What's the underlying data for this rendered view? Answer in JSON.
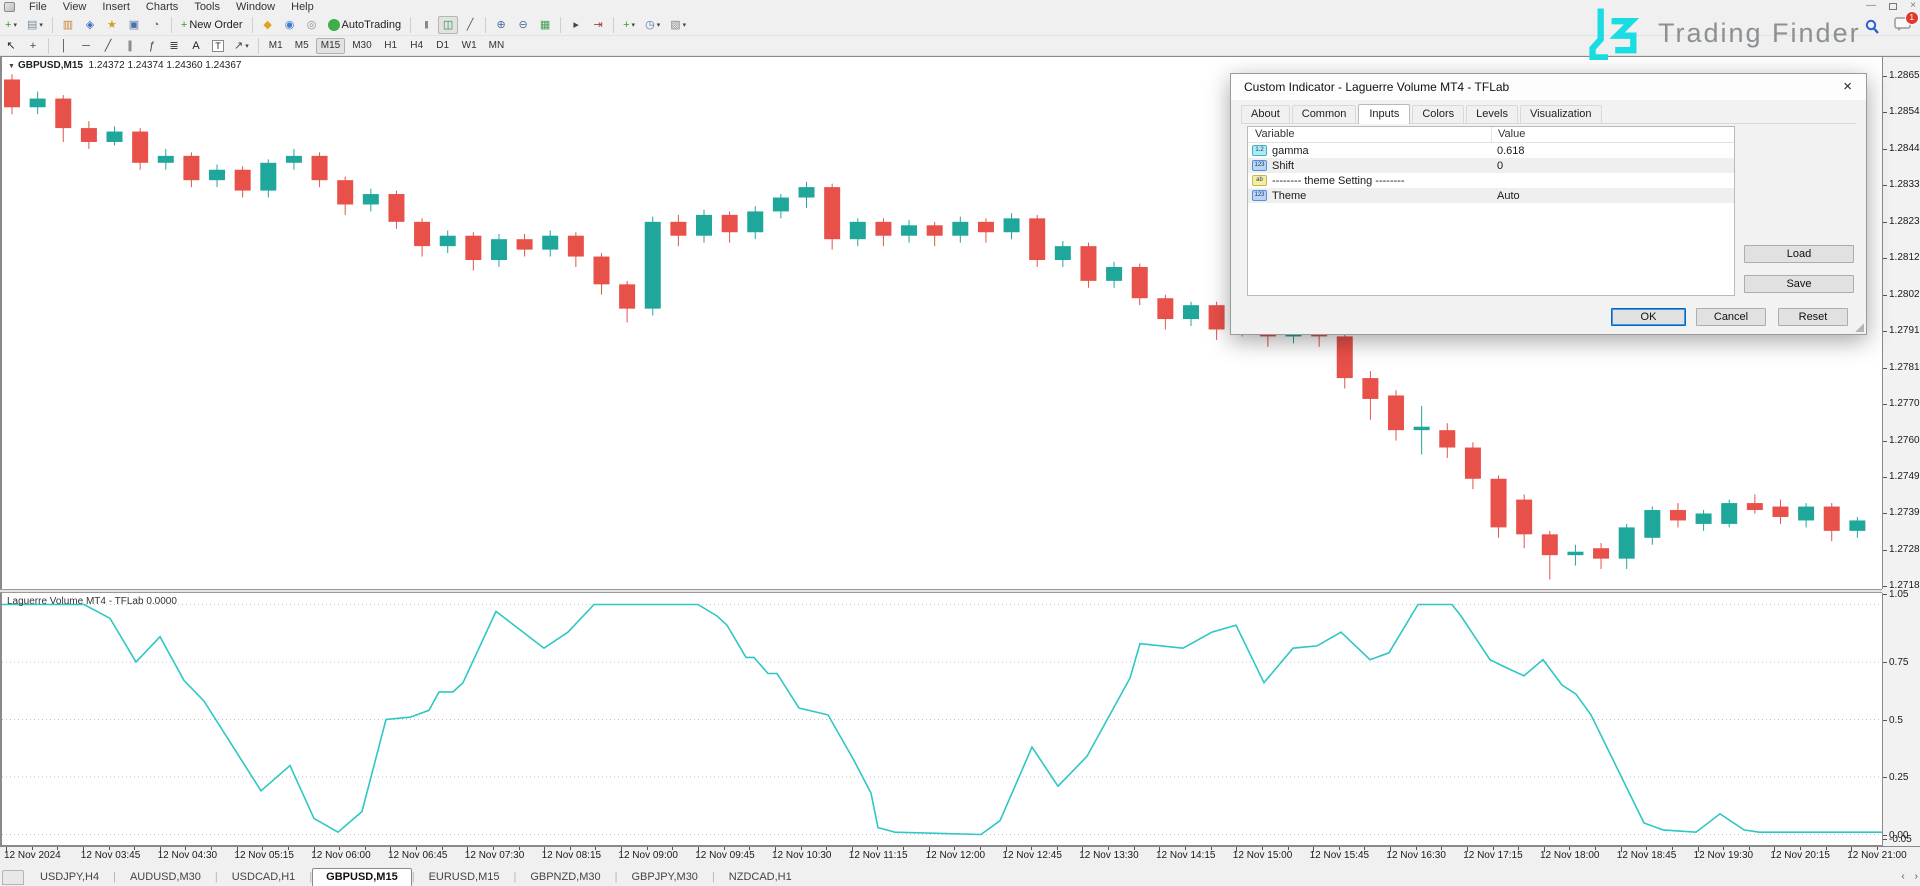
{
  "menu": {
    "items": [
      "File",
      "View",
      "Insert",
      "Charts",
      "Tools",
      "Window",
      "Help"
    ]
  },
  "window_controls": {
    "minimize": "—",
    "close": "×"
  },
  "logo": {
    "text": "Trading Finder",
    "accent": "#19dde2"
  },
  "notifications": {
    "badge": "1"
  },
  "toolbar": {
    "row1": [
      {
        "name": "new-chart",
        "glyph": "+",
        "color": "#2e9e3f",
        "dropdown": true
      },
      {
        "name": "profiles",
        "glyph": "▤",
        "color": "#7a8aa0",
        "dropdown": true
      },
      {
        "sep": true
      },
      {
        "name": "market-watch",
        "glyph": "▥",
        "color": "#c9822f"
      },
      {
        "name": "data-window",
        "glyph": "◈",
        "color": "#3a6fc4"
      },
      {
        "name": "navigator",
        "glyph": "★",
        "color": "#d4a017"
      },
      {
        "name": "terminal",
        "glyph": "▣",
        "color": "#4a6fa5"
      },
      {
        "name": "strategy-tester",
        "glyph": "◔",
        "color": "#6a6a6a"
      },
      {
        "sep": true
      },
      {
        "name": "new-order",
        "glyph": "+",
        "color": "#2e9e3f",
        "label": "New Order"
      },
      {
        "sep": true
      },
      {
        "name": "metaeditor",
        "glyph": "◆",
        "color": "#e0a020"
      },
      {
        "name": "community",
        "glyph": "◉",
        "color": "#3a7fd4"
      },
      {
        "name": "news",
        "glyph": "◎",
        "color": "#8a8a8a"
      },
      {
        "name": "autotrading",
        "circle": true,
        "color": "#3fae49",
        "label": "AutoTrading"
      },
      {
        "sep": true
      },
      {
        "name": "bar-chart",
        "glyph": "|||",
        "small": true,
        "color": "#555555"
      },
      {
        "name": "candlestick-chart",
        "glyph": "◫",
        "color": "#2e8e3e",
        "active": true
      },
      {
        "name": "line-chart",
        "glyph": "╱",
        "color": "#555555"
      },
      {
        "sep": true
      },
      {
        "name": "zoom-in",
        "glyph": "⊕",
        "color": "#4a6fa5"
      },
      {
        "name": "zoom-out",
        "glyph": "⊖",
        "color": "#4a6fa5"
      },
      {
        "name": "tile-windows",
        "glyph": "▦",
        "color": "#3f9e4f"
      },
      {
        "sep": true
      },
      {
        "name": "auto-scroll",
        "glyph": "▸",
        "color": "#444444"
      },
      {
        "name": "chart-shift",
        "glyph": "⇥",
        "color": "#a04040"
      },
      {
        "sep": true
      },
      {
        "name": "indicators",
        "glyph": "+",
        "color": "#2e9e3f",
        "dropdown": true
      },
      {
        "name": "periods",
        "glyph": "◷",
        "color": "#4a6fa5",
        "dropdown": true
      },
      {
        "name": "templates",
        "glyph": "▧",
        "color": "#8a8a8a",
        "dropdown": true
      }
    ],
    "row2": [
      {
        "name": "cursor",
        "glyph": "↖",
        "color": "#222222"
      },
      {
        "name": "crosshair",
        "glyph": "+",
        "color": "#444444"
      },
      {
        "sep": true
      },
      {
        "name": "vertical-line",
        "glyph": "│",
        "color": "#444444"
      },
      {
        "name": "horizontal-line",
        "glyph": "─",
        "color": "#444444"
      },
      {
        "name": "trendline",
        "glyph": "╱",
        "color": "#444444"
      },
      {
        "name": "equidistant-channel",
        "glyph": "∥",
        "color": "#444444"
      },
      {
        "name": "fibonacci",
        "glyph": "ƒ",
        "color": "#444444"
      },
      {
        "name": "cycle-lines",
        "glyph": "≣",
        "color": "#444444"
      },
      {
        "name": "text",
        "glyph": "A",
        "color": "#222222"
      },
      {
        "name": "label",
        "glyph": "T",
        "boxed": true,
        "color": "#222222"
      },
      {
        "name": "arrows",
        "glyph": "↗",
        "color": "#444444",
        "dropdown": true
      },
      {
        "sep": true
      }
    ],
    "timeframes": [
      "M1",
      "M5",
      "M15",
      "M30",
      "H1",
      "H4",
      "D1",
      "W1",
      "MN"
    ],
    "active_timeframe": "M15"
  },
  "chart": {
    "symbol": "GBPUSD,M15",
    "ohlc": "1.24372 1.24374 1.24360 1.24367",
    "up_color": "#1fa79b",
    "down_color": "#e8504a",
    "price_axis": [
      "1.28650",
      "1.28545",
      "1.28440",
      "1.28335",
      "1.28230",
      "1.28125",
      "1.28020",
      "1.27915",
      "1.27810",
      "1.27705",
      "1.27600",
      "1.27495",
      "1.27390",
      "1.27285",
      "1.27180"
    ],
    "candles": [
      [
        1.2864,
        1.28655,
        1.2854,
        1.2856
      ],
      [
        1.2856,
        1.28605,
        1.2854,
        1.28585
      ],
      [
        1.28585,
        1.28595,
        1.2846,
        1.285
      ],
      [
        1.285,
        1.2852,
        1.2844,
        1.2846
      ],
      [
        1.2846,
        1.28505,
        1.2845,
        1.2849
      ],
      [
        1.2849,
        1.285,
        1.2838,
        1.284
      ],
      [
        1.284,
        1.2844,
        1.2838,
        1.2842
      ],
      [
        1.2842,
        1.2843,
        1.2833,
        1.2835
      ],
      [
        1.2835,
        1.28395,
        1.2833,
        1.2838
      ],
      [
        1.2838,
        1.2839,
        1.283,
        1.2832
      ],
      [
        1.2832,
        1.2841,
        1.283,
        1.284
      ],
      [
        1.284,
        1.2844,
        1.2838,
        1.2842
      ],
      [
        1.2842,
        1.2843,
        1.2833,
        1.2835
      ],
      [
        1.2835,
        1.2836,
        1.2825,
        1.2828
      ],
      [
        1.2828,
        1.28325,
        1.2826,
        1.2831
      ],
      [
        1.2831,
        1.2832,
        1.2821,
        1.2823
      ],
      [
        1.2823,
        1.2824,
        1.2813,
        1.2816
      ],
      [
        1.2816,
        1.28205,
        1.2814,
        1.2819
      ],
      [
        1.2819,
        1.282,
        1.2809,
        1.2812
      ],
      [
        1.2812,
        1.28195,
        1.281,
        1.2818
      ],
      [
        1.2818,
        1.28195,
        1.2813,
        1.2815
      ],
      [
        1.2815,
        1.28205,
        1.2813,
        1.2819
      ],
      [
        1.2819,
        1.282,
        1.281,
        1.2813
      ],
      [
        1.2813,
        1.2814,
        1.2802,
        1.2805
      ],
      [
        1.2805,
        1.2806,
        1.2794,
        1.2798
      ],
      [
        1.2798,
        1.28245,
        1.2796,
        1.2823
      ],
      [
        1.2823,
        1.2825,
        1.2816,
        1.2819
      ],
      [
        1.2819,
        1.28265,
        1.2817,
        1.2825
      ],
      [
        1.2825,
        1.2826,
        1.2817,
        1.282
      ],
      [
        1.282,
        1.28275,
        1.2818,
        1.2826
      ],
      [
        1.2826,
        1.2831,
        1.2824,
        1.283
      ],
      [
        1.283,
        1.28345,
        1.2827,
        1.2833
      ],
      [
        1.2833,
        1.2834,
        1.2815,
        1.2818
      ],
      [
        1.2818,
        1.2824,
        1.2816,
        1.2823
      ],
      [
        1.2823,
        1.2824,
        1.2816,
        1.2819
      ],
      [
        1.2819,
        1.28235,
        1.2817,
        1.2822
      ],
      [
        1.2822,
        1.2823,
        1.2816,
        1.2819
      ],
      [
        1.2819,
        1.28245,
        1.2817,
        1.2823
      ],
      [
        1.2823,
        1.2824,
        1.2817,
        1.282
      ],
      [
        1.282,
        1.28255,
        1.2818,
        1.2824
      ],
      [
        1.2824,
        1.2825,
        1.281,
        1.2812
      ],
      [
        1.2812,
        1.28175,
        1.281,
        1.2816
      ],
      [
        1.2816,
        1.2817,
        1.2804,
        1.2806
      ],
      [
        1.2806,
        1.28115,
        1.2804,
        1.281
      ],
      [
        1.281,
        1.2811,
        1.2799,
        1.2801
      ],
      [
        1.2801,
        1.2802,
        1.2792,
        1.2795
      ],
      [
        1.2795,
        1.28,
        1.2793,
        1.2799
      ],
      [
        1.2799,
        1.28,
        1.2789,
        1.2792
      ],
      [
        1.2792,
        1.2797,
        1.279,
        1.2796
      ],
      [
        1.2796,
        1.2797,
        1.2787,
        1.279
      ],
      [
        1.279,
        1.2795,
        1.2788,
        1.2794
      ],
      [
        1.2794,
        1.2795,
        1.2787,
        1.279
      ],
      [
        1.279,
        1.27915,
        1.2775,
        1.2778
      ],
      [
        1.2778,
        1.278,
        1.2766,
        1.2772
      ],
      [
        1.2773,
        1.27745,
        1.276,
        1.2763
      ],
      [
        1.2763,
        1.277,
        1.2756,
        1.2764
      ],
      [
        1.2763,
        1.2765,
        1.2755,
        1.2758
      ],
      [
        1.2758,
        1.27595,
        1.2746,
        1.2749
      ],
      [
        1.2749,
        1.275,
        1.2732,
        1.2735
      ],
      [
        1.2743,
        1.27445,
        1.2729,
        1.2733
      ],
      [
        1.2733,
        1.2734,
        1.272,
        1.2727
      ],
      [
        1.2727,
        1.273,
        1.2724,
        1.2728
      ],
      [
        1.2729,
        1.27305,
        1.2723,
        1.2726
      ],
      [
        1.2726,
        1.2736,
        1.2723,
        1.2735
      ],
      [
        1.2732,
        1.2741,
        1.273,
        1.274
      ],
      [
        1.274,
        1.2742,
        1.2735,
        1.2737
      ],
      [
        1.2736,
        1.274,
        1.2734,
        1.2739
      ],
      [
        1.2736,
        1.2743,
        1.2735,
        1.2742
      ],
      [
        1.2742,
        1.27445,
        1.2739,
        1.274
      ],
      [
        1.2741,
        1.2743,
        1.2736,
        1.2738
      ],
      [
        1.2737,
        1.2742,
        1.2735,
        1.2741
      ],
      [
        1.2741,
        1.2742,
        1.2731,
        1.2734
      ],
      [
        1.2734,
        1.2738,
        1.2732,
        1.2737
      ]
    ]
  },
  "indicator": {
    "label": "Laguerre Volume MT4 - TFLab 0.0000",
    "color": "#2dc7c4",
    "axis_labels": [
      {
        "text": "1.05",
        "value": 1.05
      },
      {
        "text": "0.75",
        "value": 0.75
      },
      {
        "text": "0.5",
        "value": 0.5
      },
      {
        "text": "0.25",
        "value": 0.25
      },
      {
        "text": "0.00",
        "value": 0.0
      },
      {
        "text": "-0.05",
        "value": -0.05
      }
    ],
    "levels": [
      0.0,
      0.25,
      0.5,
      0.75,
      1.0
    ],
    "points": [
      [
        0,
        1.0
      ],
      [
        82,
        1.0
      ],
      [
        108,
        0.94
      ],
      [
        134,
        0.75
      ],
      [
        158,
        0.86
      ],
      [
        182,
        0.67
      ],
      [
        202,
        0.58
      ],
      [
        259,
        0.19
      ],
      [
        288,
        0.3
      ],
      [
        312,
        0.07
      ],
      [
        336,
        0.01
      ],
      [
        360,
        0.1
      ],
      [
        384,
        0.5
      ],
      [
        408,
        0.51
      ],
      [
        427,
        0.54
      ],
      [
        437,
        0.62
      ],
      [
        451,
        0.62
      ],
      [
        461,
        0.66
      ],
      [
        494,
        0.97
      ],
      [
        509,
        0.92
      ],
      [
        542,
        0.81
      ],
      [
        566,
        0.88
      ],
      [
        592,
        1.0
      ],
      [
        696,
        1.0
      ],
      [
        715,
        0.95
      ],
      [
        725,
        0.91
      ],
      [
        744,
        0.77
      ],
      [
        752,
        0.77
      ],
      [
        766,
        0.7
      ],
      [
        775,
        0.7
      ],
      [
        797,
        0.55
      ],
      [
        826,
        0.52
      ],
      [
        851,
        0.33
      ],
      [
        869,
        0.18
      ],
      [
        876,
        0.03
      ],
      [
        893,
        0.01
      ],
      [
        979,
        0.0
      ],
      [
        998,
        0.06
      ],
      [
        1030,
        0.38
      ],
      [
        1056,
        0.21
      ],
      [
        1085,
        0.34
      ],
      [
        1104,
        0.49
      ],
      [
        1128,
        0.68
      ],
      [
        1138,
        0.83
      ],
      [
        1181,
        0.81
      ],
      [
        1210,
        0.88
      ],
      [
        1234,
        0.91
      ],
      [
        1262,
        0.66
      ],
      [
        1291,
        0.81
      ],
      [
        1315,
        0.82
      ],
      [
        1339,
        0.88
      ],
      [
        1368,
        0.76
      ],
      [
        1387,
        0.79
      ],
      [
        1416,
        1.0
      ],
      [
        1450,
        1.0
      ],
      [
        1459,
        0.95
      ],
      [
        1488,
        0.76
      ],
      [
        1502,
        0.73
      ],
      [
        1522,
        0.69
      ],
      [
        1541,
        0.76
      ],
      [
        1560,
        0.65
      ],
      [
        1574,
        0.61
      ],
      [
        1589,
        0.52
      ],
      [
        1642,
        0.05
      ],
      [
        1661,
        0.02
      ],
      [
        1694,
        0.01
      ],
      [
        1718,
        0.09
      ],
      [
        1742,
        0.02
      ],
      [
        1757,
        0.01
      ],
      [
        1880,
        0.01
      ]
    ]
  },
  "time_axis": {
    "labels": [
      "12 Nov 2024",
      "12 Nov 03:45",
      "12 Nov 04:30",
      "12 Nov 05:15",
      "12 Nov 06:00",
      "12 Nov 06:45",
      "12 Nov 07:30",
      "12 Nov 08:15",
      "12 Nov 09:00",
      "12 Nov 09:45",
      "12 Nov 10:30",
      "12 Nov 11:15",
      "12 Nov 12:00",
      "12 Nov 12:45",
      "12 Nov 13:30",
      "12 Nov 14:15",
      "12 Nov 15:00",
      "12 Nov 15:45",
      "12 Nov 16:30",
      "12 Nov 17:15",
      "12 Nov 18:00",
      "12 Nov 18:45",
      "12 Nov 19:30",
      "12 Nov 20:15",
      "12 Nov 21:00"
    ]
  },
  "tabs": {
    "items": [
      "USDJPY,H4",
      "AUDUSD,M30",
      "USDCAD,H1",
      "GBPUSD,M15",
      "EURUSD,M15",
      "GBPNZD,M30",
      "GBPJPY,M30",
      "NZDCAD,H1"
    ],
    "active": "GBPUSD,M15",
    "scroll_left": "‹",
    "scroll_right": "›"
  },
  "dialog": {
    "title": "Custom Indicator - Laguerre Volume MT4 - TFLab",
    "close_glyph": "×",
    "tabs": [
      "About",
      "Common",
      "Inputs",
      "Colors",
      "Levels",
      "Visualization"
    ],
    "active_tab": "Inputs",
    "table": {
      "headers": [
        "Variable",
        "Value"
      ],
      "rows": [
        {
          "icon_name": "double-type",
          "icon_text": "1.2",
          "icon_bg": "#aee9f2",
          "icon_border": "#3fb5c9",
          "name": "gamma",
          "value": "0.618"
        },
        {
          "icon_name": "integer-type",
          "icon_text": "123",
          "icon_bg": "#b9d4f7",
          "icon_border": "#5a8fd6",
          "name": "Shift",
          "value": "0"
        },
        {
          "icon_name": "string-type",
          "icon_text": "ab",
          "icon_bg": "#f5eda6",
          "icon_border": "#c9b94d",
          "name": "-------- theme Setting --------",
          "value": ""
        },
        {
          "icon_name": "integer-type",
          "icon_text": "123",
          "icon_bg": "#b9d4f7",
          "icon_border": "#5a8fd6",
          "name": "Theme",
          "value": "Auto"
        }
      ]
    },
    "buttons": {
      "load": "Load",
      "save": "Save",
      "ok": "OK",
      "cancel": "Cancel",
      "reset": "Reset"
    }
  }
}
